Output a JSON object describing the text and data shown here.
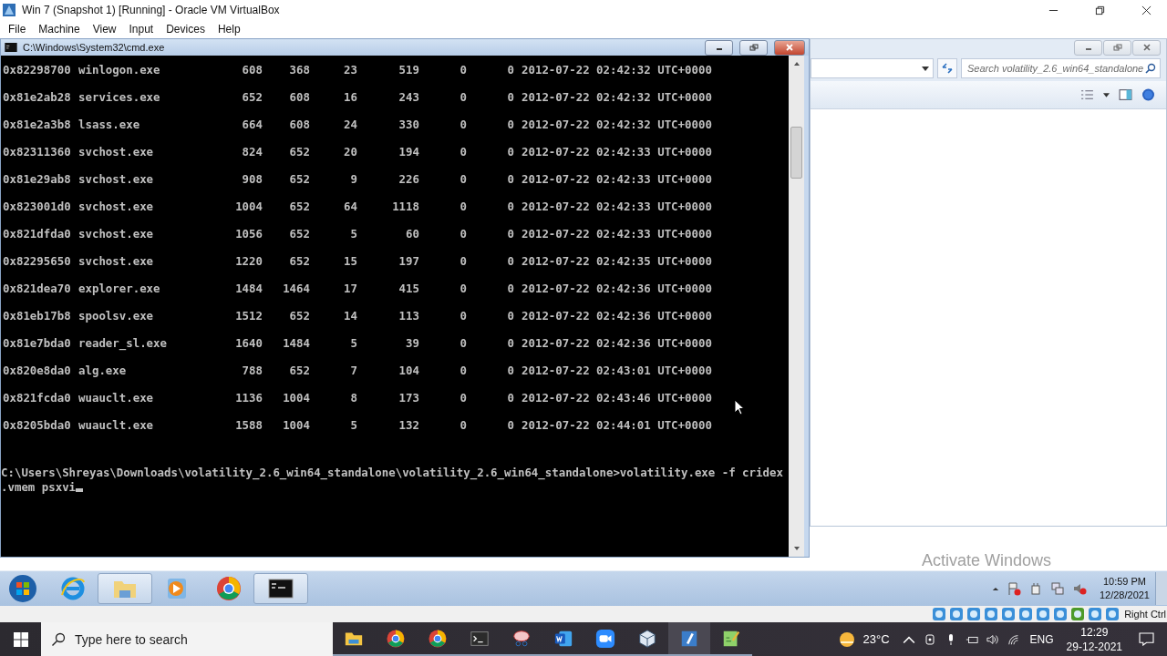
{
  "host_window": {
    "title": "Win 7 (Snapshot 1) [Running] - Oracle VM VirtualBox"
  },
  "menu": [
    "File",
    "Machine",
    "View",
    "Input",
    "Devices",
    "Help"
  ],
  "cmd_window": {
    "title": "C:\\Windows\\System32\\cmd.exe",
    "rows": [
      {
        "offset": "0x82298700",
        "name": "winlogon.exe",
        "pid": "608",
        "ppid": "368",
        "thds": "23",
        "hnds": "519",
        "sess": "0",
        "wow64": "0",
        "start": "2012-07-22 02:42:32 UTC+0000"
      },
      {
        "offset": "0x81e2ab28",
        "name": "services.exe",
        "pid": "652",
        "ppid": "608",
        "thds": "16",
        "hnds": "243",
        "sess": "0",
        "wow64": "0",
        "start": "2012-07-22 02:42:32 UTC+0000"
      },
      {
        "offset": "0x81e2a3b8",
        "name": "lsass.exe",
        "pid": "664",
        "ppid": "608",
        "thds": "24",
        "hnds": "330",
        "sess": "0",
        "wow64": "0",
        "start": "2012-07-22 02:42:32 UTC+0000"
      },
      {
        "offset": "0x82311360",
        "name": "svchost.exe",
        "pid": "824",
        "ppid": "652",
        "thds": "20",
        "hnds": "194",
        "sess": "0",
        "wow64": "0",
        "start": "2012-07-22 02:42:33 UTC+0000"
      },
      {
        "offset": "0x81e29ab8",
        "name": "svchost.exe",
        "pid": "908",
        "ppid": "652",
        "thds": "9",
        "hnds": "226",
        "sess": "0",
        "wow64": "0",
        "start": "2012-07-22 02:42:33 UTC+0000"
      },
      {
        "offset": "0x823001d0",
        "name": "svchost.exe",
        "pid": "1004",
        "ppid": "652",
        "thds": "64",
        "hnds": "1118",
        "sess": "0",
        "wow64": "0",
        "start": "2012-07-22 02:42:33 UTC+0000"
      },
      {
        "offset": "0x821dfda0",
        "name": "svchost.exe",
        "pid": "1056",
        "ppid": "652",
        "thds": "5",
        "hnds": "60",
        "sess": "0",
        "wow64": "0",
        "start": "2012-07-22 02:42:33 UTC+0000"
      },
      {
        "offset": "0x82295650",
        "name": "svchost.exe",
        "pid": "1220",
        "ppid": "652",
        "thds": "15",
        "hnds": "197",
        "sess": "0",
        "wow64": "0",
        "start": "2012-07-22 02:42:35 UTC+0000"
      },
      {
        "offset": "0x821dea70",
        "name": "explorer.exe",
        "pid": "1484",
        "ppid": "1464",
        "thds": "17",
        "hnds": "415",
        "sess": "0",
        "wow64": "0",
        "start": "2012-07-22 02:42:36 UTC+0000"
      },
      {
        "offset": "0x81eb17b8",
        "name": "spoolsv.exe",
        "pid": "1512",
        "ppid": "652",
        "thds": "14",
        "hnds": "113",
        "sess": "0",
        "wow64": "0",
        "start": "2012-07-22 02:42:36 UTC+0000"
      },
      {
        "offset": "0x81e7bda0",
        "name": "reader_sl.exe",
        "pid": "1640",
        "ppid": "1484",
        "thds": "5",
        "hnds": "39",
        "sess": "0",
        "wow64": "0",
        "start": "2012-07-22 02:42:36 UTC+0000"
      },
      {
        "offset": "0x820e8da0",
        "name": "alg.exe",
        "pid": "788",
        "ppid": "652",
        "thds": "7",
        "hnds": "104",
        "sess": "0",
        "wow64": "0",
        "start": "2012-07-22 02:43:01 UTC+0000"
      },
      {
        "offset": "0x821fcda0",
        "name": "wuauclt.exe",
        "pid": "1136",
        "ppid": "1004",
        "thds": "8",
        "hnds": "173",
        "sess": "0",
        "wow64": "0",
        "start": "2012-07-22 02:43:46 UTC+0000"
      },
      {
        "offset": "0x8205bda0",
        "name": "wuauclt.exe",
        "pid": "1588",
        "ppid": "1004",
        "thds": "5",
        "hnds": "132",
        "sess": "0",
        "wow64": "0",
        "start": "2012-07-22 02:44:01 UTC+0000"
      }
    ],
    "command_lines": [
      "C:\\Users\\Shreyas\\Downloads\\volatility_2.6_win64_standalone\\volatility_2.6_win64_standalone>volatility.exe -f cridex",
      ".vmem psxvi"
    ]
  },
  "explorer_window": {
    "search": {
      "placeholder": "Search volatility_2.6_win64_standalone"
    }
  },
  "activation_notice": "Activate Windows",
  "guest_taskbar": {
    "apps": [
      {
        "kind": "ie",
        "selected": false
      },
      {
        "kind": "folder",
        "selected": true
      },
      {
        "kind": "media",
        "selected": false
      },
      {
        "kind": "chrome",
        "selected": false
      },
      {
        "kind": "console",
        "selected": true
      }
    ],
    "time": "10:59 PM",
    "date": "12/28/2021"
  },
  "status_bar": {
    "host_key": "Right Ctrl"
  },
  "host_taskbar": {
    "search": {
      "placeholder": "Type here to search"
    },
    "apps": [
      {
        "kind": "folder",
        "selected": false
      },
      {
        "kind": "chrome",
        "selected": false
      },
      {
        "kind": "chrome",
        "selected": false
      },
      {
        "kind": "terminal",
        "selected": false
      },
      {
        "kind": "snip",
        "selected": false
      },
      {
        "kind": "word",
        "selected": false
      },
      {
        "kind": "video",
        "selected": false
      },
      {
        "kind": "cube",
        "selected": false
      },
      {
        "kind": "vm",
        "selected": true
      },
      {
        "kind": "notes",
        "selected": false
      }
    ],
    "temperature": "23°C",
    "language": "ENG",
    "time": "12:29",
    "date": "29-12-2021"
  }
}
